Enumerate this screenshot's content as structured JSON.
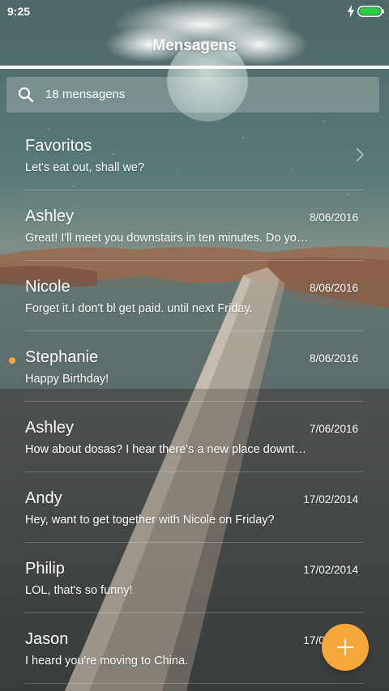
{
  "status_bar": {
    "time": "9:25",
    "battery_color": "#2ecc40",
    "charging": true
  },
  "header": {
    "title": "Mensagens"
  },
  "search": {
    "label": "18 mensagens",
    "icon": "search-icon"
  },
  "colors": {
    "accent": "#f4a83a",
    "unread_dot": "#f4a83a",
    "text": "#ffffff"
  },
  "messages": [
    {
      "name": "Favoritos",
      "preview": "Let's eat out, shall we?",
      "date": "",
      "unread": false,
      "chevron": true
    },
    {
      "name": "Ashley",
      "preview": "Great! I'll meet you downstairs in ten minutes. Do you want to get dinner?",
      "date": "8/06/2016",
      "unread": false,
      "chevron": false
    },
    {
      "name": "Nicole",
      "preview": "Forget it.I don't bl get paid. until next Friday.",
      "date": "8/06/2016",
      "unread": false,
      "chevron": false
    },
    {
      "name": "Stephanie",
      "preview": "Happy Birthday!",
      "date": "8/06/2016",
      "unread": true,
      "chevron": false
    },
    {
      "name": "Ashley",
      "preview": "How about dosas? I hear there's a new place downtown.",
      "date": "7/06/2016",
      "unread": false,
      "chevron": false
    },
    {
      "name": "Andy",
      "preview": "Hey, want to get together with Nicole on Friday?",
      "date": "17/02/2014",
      "unread": false,
      "chevron": false
    },
    {
      "name": "Philip",
      "preview": "LOL, that's so funny!",
      "date": "17/02/2014",
      "unread": false,
      "chevron": false
    },
    {
      "name": "Jason",
      "preview": "I heard you're moving to China.",
      "date": "17/02/2014",
      "unread": false,
      "chevron": false
    }
  ],
  "fab": {
    "icon": "plus-icon"
  }
}
